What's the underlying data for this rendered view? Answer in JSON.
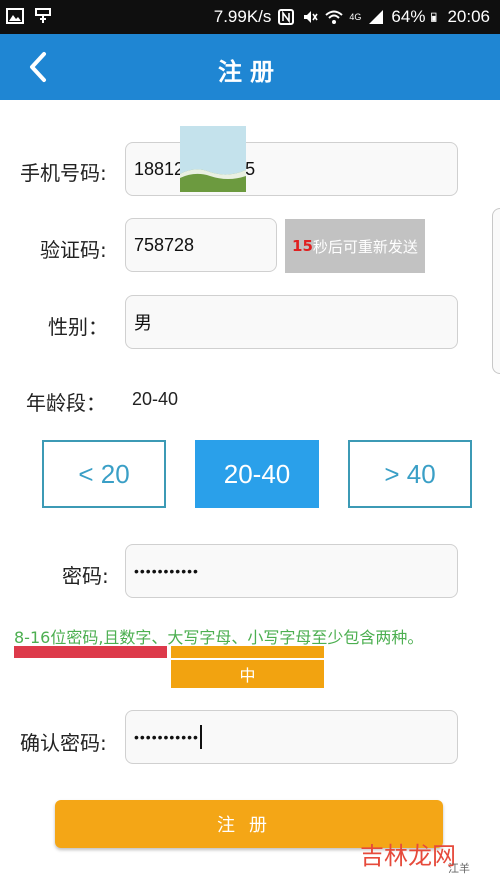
{
  "status_bar": {
    "speed": "7.99K/s",
    "network": "4G",
    "battery": "64%",
    "time": "20:06"
  },
  "header": {
    "back_icon": "chevron-left-icon",
    "title": "注册"
  },
  "form": {
    "phone_label": "手机号码:",
    "phone_value_start": "18812",
    "phone_value_end": "5",
    "code_label": "验证码:",
    "code_value": "758728",
    "resend_count": "15",
    "resend_text": "秒后可重新发送",
    "gender_label": "性别：",
    "gender_value": "男",
    "age_label": "年龄段：",
    "age_value": "20-40",
    "age_options": [
      "< 20",
      "20-40",
      "> 40"
    ],
    "password_label": "密码:",
    "password_value": "•••••••••••",
    "password_hint": "8-16位密码,且数字、大写字母、小写字母至少包含两种。",
    "strength_label": "中",
    "strength_level": "medium",
    "confirm_label": "确认密码:",
    "confirm_value": "•••••••••••",
    "submit_label": "注册"
  },
  "colors": {
    "header": "#1f86d3",
    "accent_blue": "#2aa0ea",
    "submit": "#f4a616",
    "hint_green": "#4caf50",
    "strength_red": "#dd3a4a",
    "strength_orange": "#f2a310"
  },
  "watermark": {
    "text": "吉林龙网",
    "sub": "江羊"
  }
}
